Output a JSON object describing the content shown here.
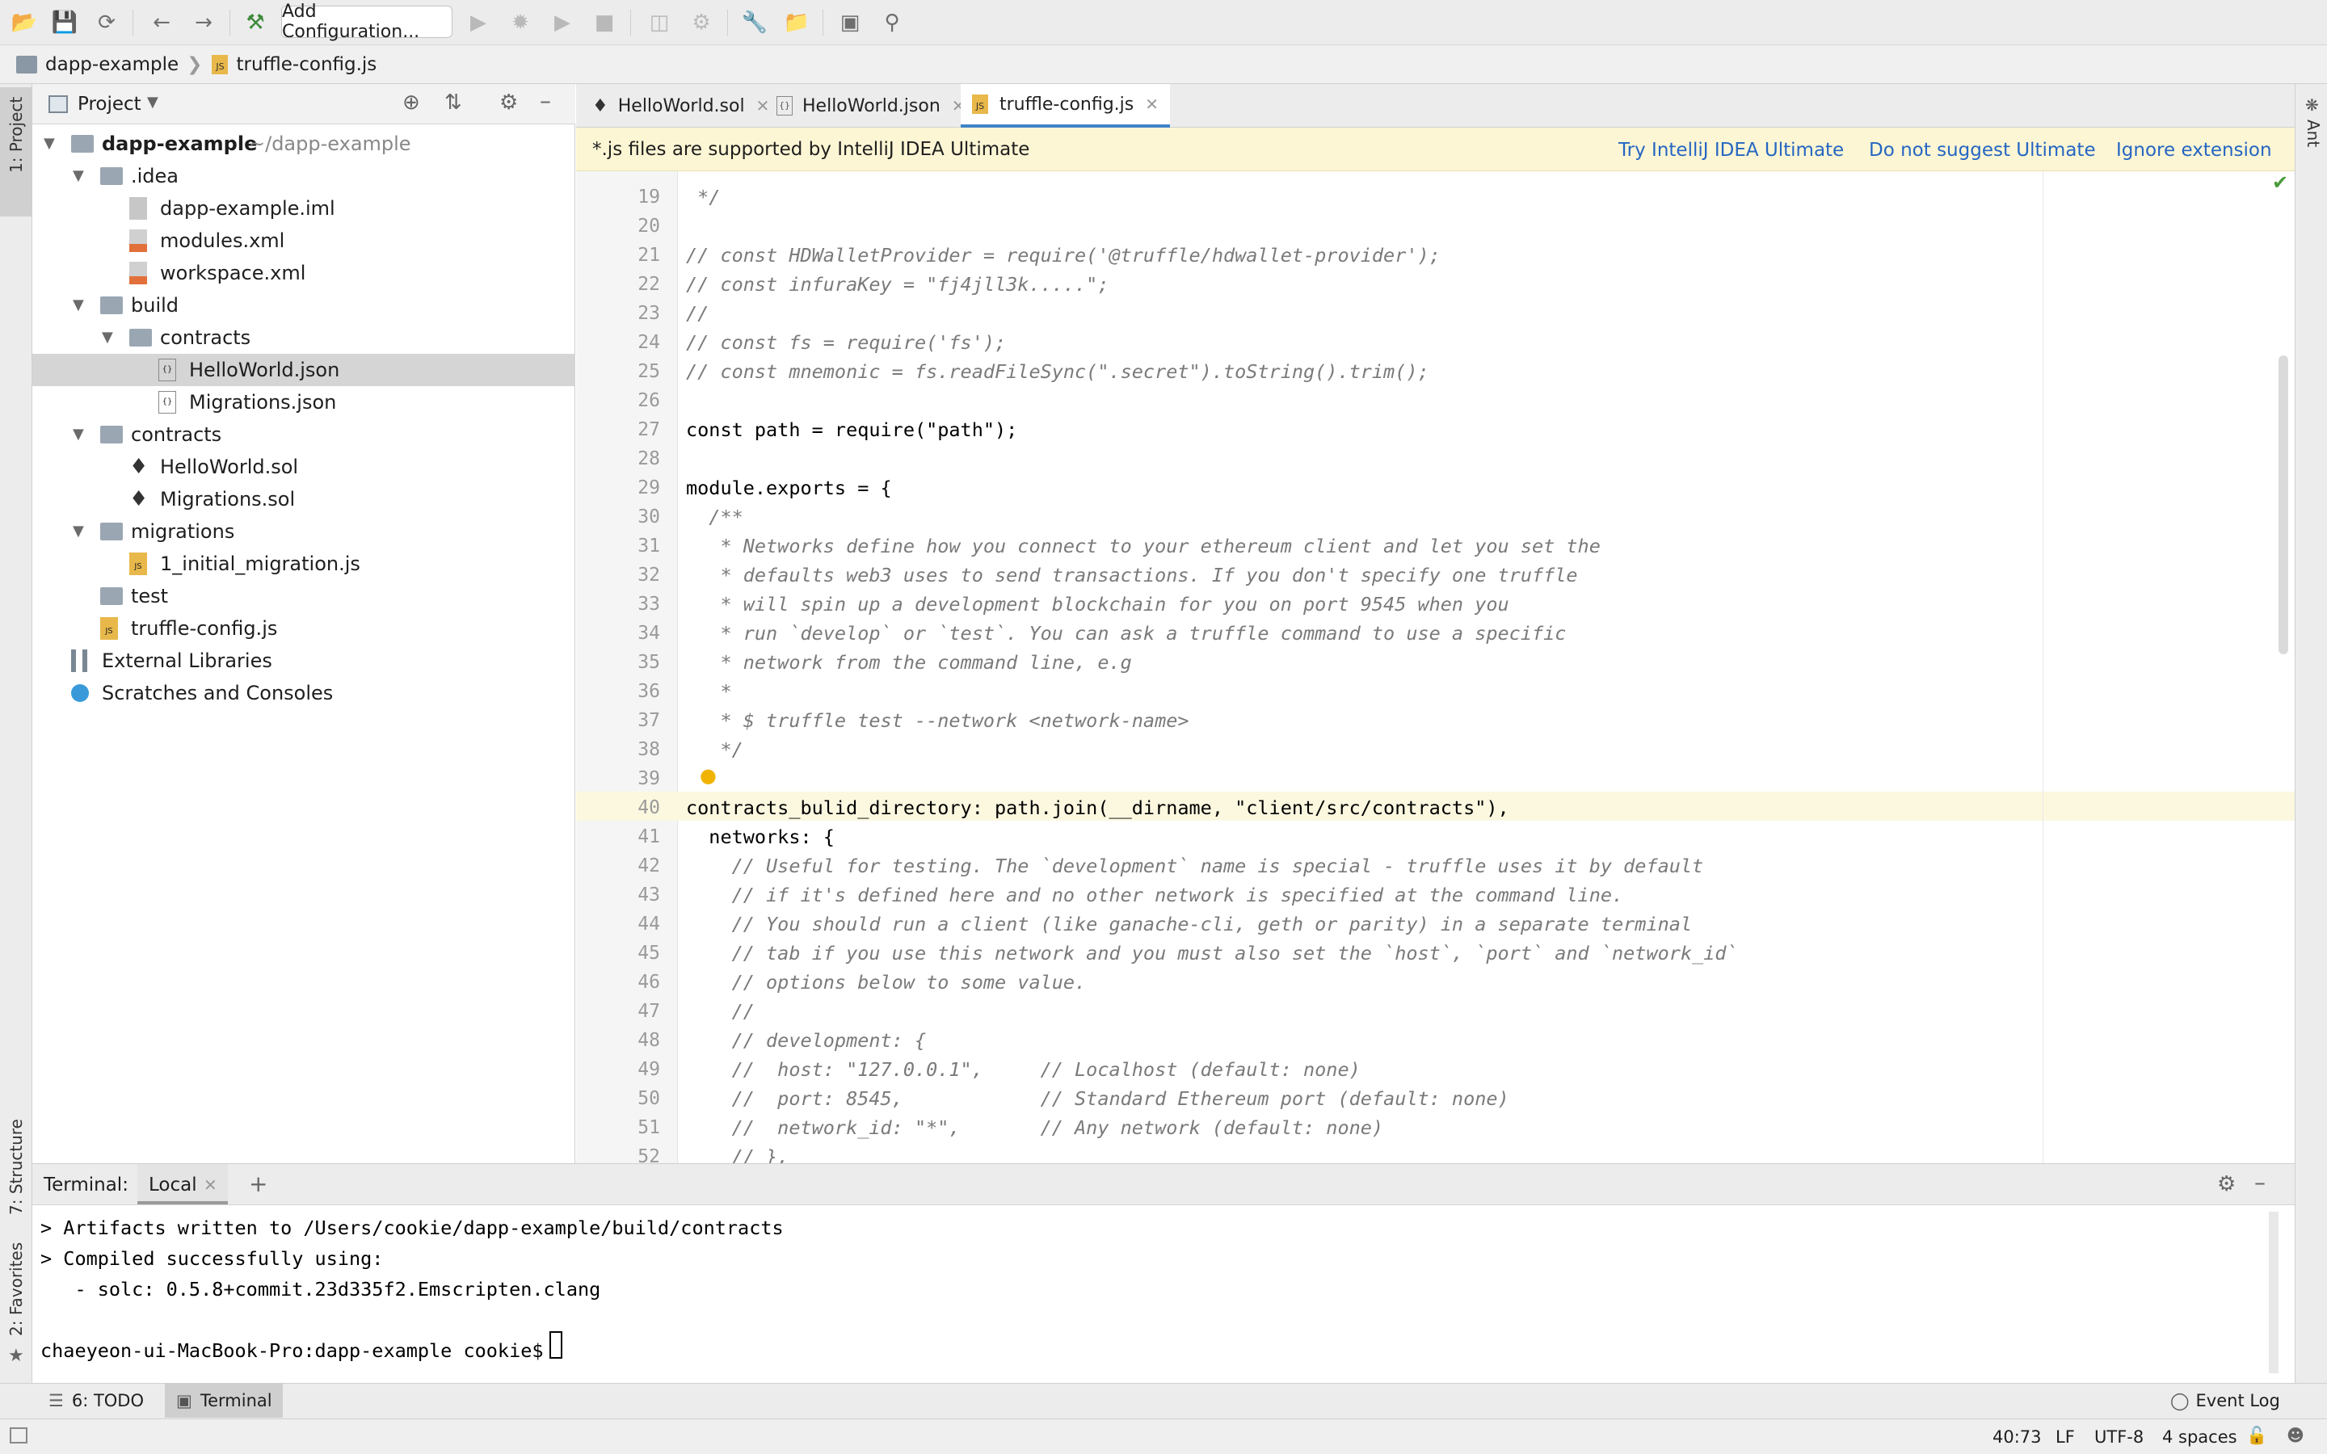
{
  "toolbar": {
    "add_configuration": "Add Configuration...",
    "icons": [
      "open-folder-icon",
      "save-icon",
      "sync-icon",
      "back-icon",
      "forward-icon",
      "build-hammer-icon",
      "run-icon",
      "debug-icon",
      "coverage-icon",
      "stop-icon",
      "attach-icon",
      "deploy-icon",
      "wrench-icon",
      "project-structure-icon",
      "terminal-icon",
      "search-icon"
    ]
  },
  "breadcrumb": {
    "project": "dapp-example",
    "file": "truffle-config.js"
  },
  "stripes": {
    "project": "1: Project",
    "structure": "7: Structure",
    "favorites": "2: Favorites",
    "ant": "Ant"
  },
  "project_panel": {
    "title": "Project",
    "tree": [
      {
        "label": "dapp-example",
        "extra": "~/dapp-example",
        "icon": "project-folder-icon",
        "depth": 0,
        "expanded": true,
        "bold": true
      },
      {
        "label": ".idea",
        "icon": "folder-icon",
        "depth": 1,
        "expanded": true
      },
      {
        "label": "dapp-example.iml",
        "icon": "iml-file-icon",
        "depth": 2
      },
      {
        "label": "modules.xml",
        "icon": "xml-file-icon",
        "depth": 2
      },
      {
        "label": "workspace.xml",
        "icon": "xml-file-icon",
        "depth": 2
      },
      {
        "label": "build",
        "icon": "folder-icon",
        "depth": 1,
        "expanded": true
      },
      {
        "label": "contracts",
        "icon": "folder-icon",
        "depth": 2,
        "expanded": true
      },
      {
        "label": "HelloWorld.json",
        "icon": "json-file-icon",
        "depth": 3,
        "selected": true
      },
      {
        "label": "Migrations.json",
        "icon": "json-file-icon",
        "depth": 3
      },
      {
        "label": "contracts",
        "icon": "folder-icon",
        "depth": 1,
        "expanded": true
      },
      {
        "label": "HelloWorld.sol",
        "icon": "ethereum-icon",
        "depth": 2
      },
      {
        "label": "Migrations.sol",
        "icon": "ethereum-icon",
        "depth": 2
      },
      {
        "label": "migrations",
        "icon": "folder-icon",
        "depth": 1,
        "expanded": true
      },
      {
        "label": "1_initial_migration.js",
        "icon": "js-file-icon",
        "depth": 2
      },
      {
        "label": "test",
        "icon": "folder-icon",
        "depth": 1
      },
      {
        "label": "truffle-config.js",
        "icon": "js-file-icon",
        "depth": 1
      },
      {
        "label": "External Libraries",
        "icon": "libraries-icon",
        "depth": 0
      },
      {
        "label": "Scratches and Consoles",
        "icon": "scratches-icon",
        "depth": 0
      }
    ]
  },
  "tabs": [
    {
      "label": "HelloWorld.sol",
      "icon": "ethereum-icon"
    },
    {
      "label": "HelloWorld.json",
      "icon": "json-file-icon"
    },
    {
      "label": "truffle-config.js",
      "icon": "js-file-icon",
      "active": true
    }
  ],
  "banner": {
    "message": "*.js files are supported by IntelliJ IDEA Ultimate",
    "try": "Try IntelliJ IDEA Ultimate",
    "dont_suggest": "Do not suggest Ultimate",
    "ignore": "Ignore extension"
  },
  "code_lines": [
    {
      "n": "19",
      "text": " */"
    },
    {
      "n": "20",
      "text": ""
    },
    {
      "n": "21",
      "text": "// const HDWalletProvider = require('@truffle/hdwallet-provider');"
    },
    {
      "n": "22",
      "text": "// const infuraKey = \"fj4jll3k.....\";"
    },
    {
      "n": "23",
      "text": "//"
    },
    {
      "n": "24",
      "text": "// const fs = require('fs');"
    },
    {
      "n": "25",
      "text": "// const mnemonic = fs.readFileSync(\".secret\").toString().trim();"
    },
    {
      "n": "26",
      "text": ""
    },
    {
      "n": "27",
      "text": "const path = require(\"path\");"
    },
    {
      "n": "28",
      "text": ""
    },
    {
      "n": "29",
      "text": "module.exports = {"
    },
    {
      "n": "30",
      "text": "  /**"
    },
    {
      "n": "31",
      "text": "   * Networks define how you connect to your ethereum client and let you set the"
    },
    {
      "n": "32",
      "text": "   * defaults web3 uses to send transactions. If you don't specify one truffle"
    },
    {
      "n": "33",
      "text": "   * will spin up a development blockchain for you on port 9545 when you"
    },
    {
      "n": "34",
      "text": "   * run `develop` or `test`. You can ask a truffle command to use a specific"
    },
    {
      "n": "35",
      "text": "   * network from the command line, e.g"
    },
    {
      "n": "36",
      "text": "   *"
    },
    {
      "n": "37",
      "text": "   * $ truffle test --network <network-name>"
    },
    {
      "n": "38",
      "text": "   */"
    },
    {
      "n": "39",
      "text": ""
    },
    {
      "n": "40",
      "text": "contracts_bulid_directory: path.join(__dirname, \"client/src/contracts\"),"
    },
    {
      "n": "41",
      "text": "  networks: {"
    },
    {
      "n": "42",
      "text": "    // Useful for testing. The `development` name is special - truffle uses it by default"
    },
    {
      "n": "43",
      "text": "    // if it's defined here and no other network is specified at the command line."
    },
    {
      "n": "44",
      "text": "    // You should run a client (like ganache-cli, geth or parity) in a separate terminal"
    },
    {
      "n": "45",
      "text": "    // tab if you use this network and you must also set the `host`, `port` and `network_id`"
    },
    {
      "n": "46",
      "text": "    // options below to some value."
    },
    {
      "n": "47",
      "text": "    //"
    },
    {
      "n": "48",
      "text": "    // development: {"
    },
    {
      "n": "49",
      "text": "    //  host: \"127.0.0.1\",     // Localhost (default: none)"
    },
    {
      "n": "50",
      "text": "    //  port: 8545,            // Standard Ethereum port (default: none)"
    },
    {
      "n": "51",
      "text": "    //  network_id: \"*\",       // Any network (default: none)"
    },
    {
      "n": "52",
      "text": "    // },"
    }
  ],
  "terminal": {
    "title": "Terminal:",
    "tab": "Local",
    "lines": [
      "> Artifacts written to /Users/cookie/dapp-example/build/contracts",
      "> Compiled successfully using:",
      "   - solc: 0.5.8+commit.23d335f2.Emscripten.clang",
      "",
      "chaeyeon-ui-MacBook-Pro:dapp-example cookie$ "
    ]
  },
  "toolwindows": {
    "todo": "6: TODO",
    "terminal": "Terminal",
    "event_log": "Event Log"
  },
  "status": {
    "position": "40:73",
    "line_sep": "LF",
    "encoding": "UTF-8",
    "indent": "4 spaces"
  }
}
